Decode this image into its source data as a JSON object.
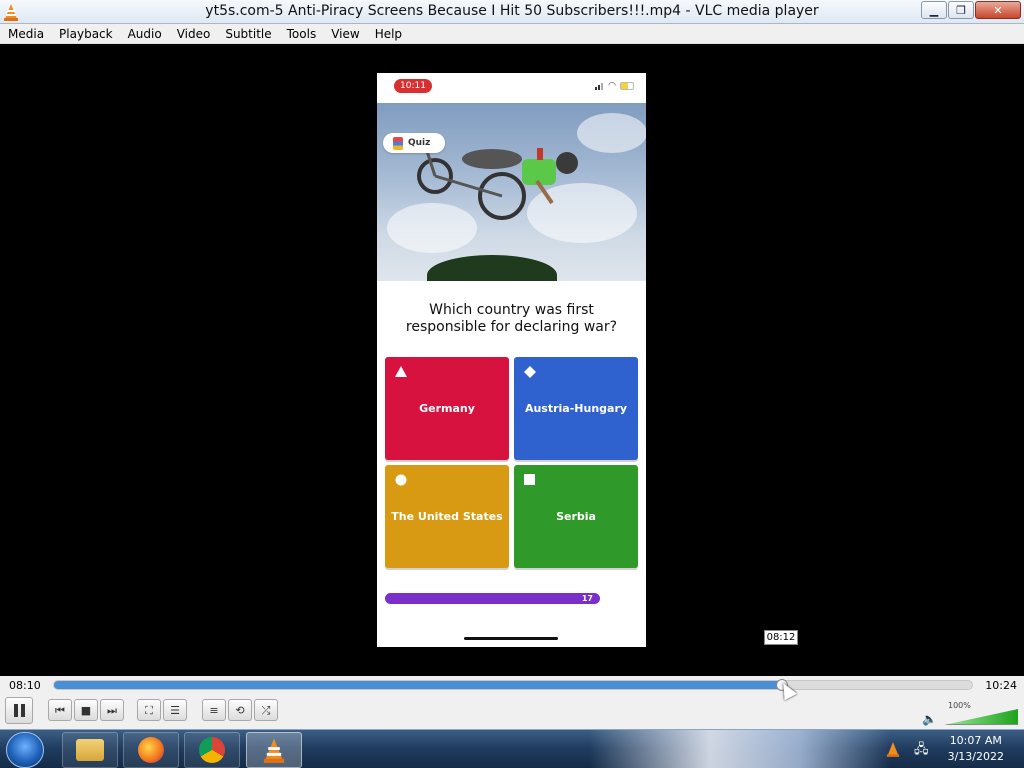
{
  "window": {
    "title": "yt5s.com-5 Anti-Piracy Screens Because I Hit 50 Subscribers!!!.mp4 - VLC media player",
    "app_icon": "vlc-cone-icon",
    "buttons": [
      "minimize-icon",
      "restore-icon",
      "close-icon"
    ]
  },
  "menu": {
    "items": [
      "Media",
      "Playback",
      "Audio",
      "Video",
      "Subtitle",
      "Tools",
      "View",
      "Help"
    ]
  },
  "video": {
    "phone": {
      "status_time": "10:11",
      "quiz_chip_label": "Quiz",
      "question": "Which country was first responsible for declaring war?",
      "answers": [
        {
          "label": "Germany",
          "shape": "triangle-icon",
          "color": "#d8123f"
        },
        {
          "label": "Austria-Hungary",
          "shape": "diamond-icon",
          "color": "#2f62cf"
        },
        {
          "label": "The United States",
          "shape": "circle-icon",
          "color": "#d89a12"
        },
        {
          "label": "Serbia",
          "shape": "square-icon",
          "color": "#2f9a2a"
        }
      ],
      "timer_value": "17",
      "timer_color": "#7a2fc9"
    },
    "seek_tooltip": "08:12"
  },
  "controls": {
    "elapsed": "08:10",
    "total": "10:24",
    "progress_fraction": 0.793,
    "volume_label": "100%",
    "volume_level": 1.0,
    "buttons": [
      "pause-icon",
      "previous-icon",
      "stop-icon",
      "next-icon",
      "fullscreen-icon",
      "extended-settings-icon",
      "playlist-icon",
      "loop-icon",
      "shuffle-icon"
    ],
    "accent": "#4a8fd4"
  },
  "taskbar": {
    "apps": [
      "windows-start-icon",
      "file-explorer-icon",
      "firefox-icon",
      "chrome-icon",
      "vlc-icon"
    ],
    "clock_time": "10:07 AM",
    "clock_date": "3/13/2022"
  }
}
